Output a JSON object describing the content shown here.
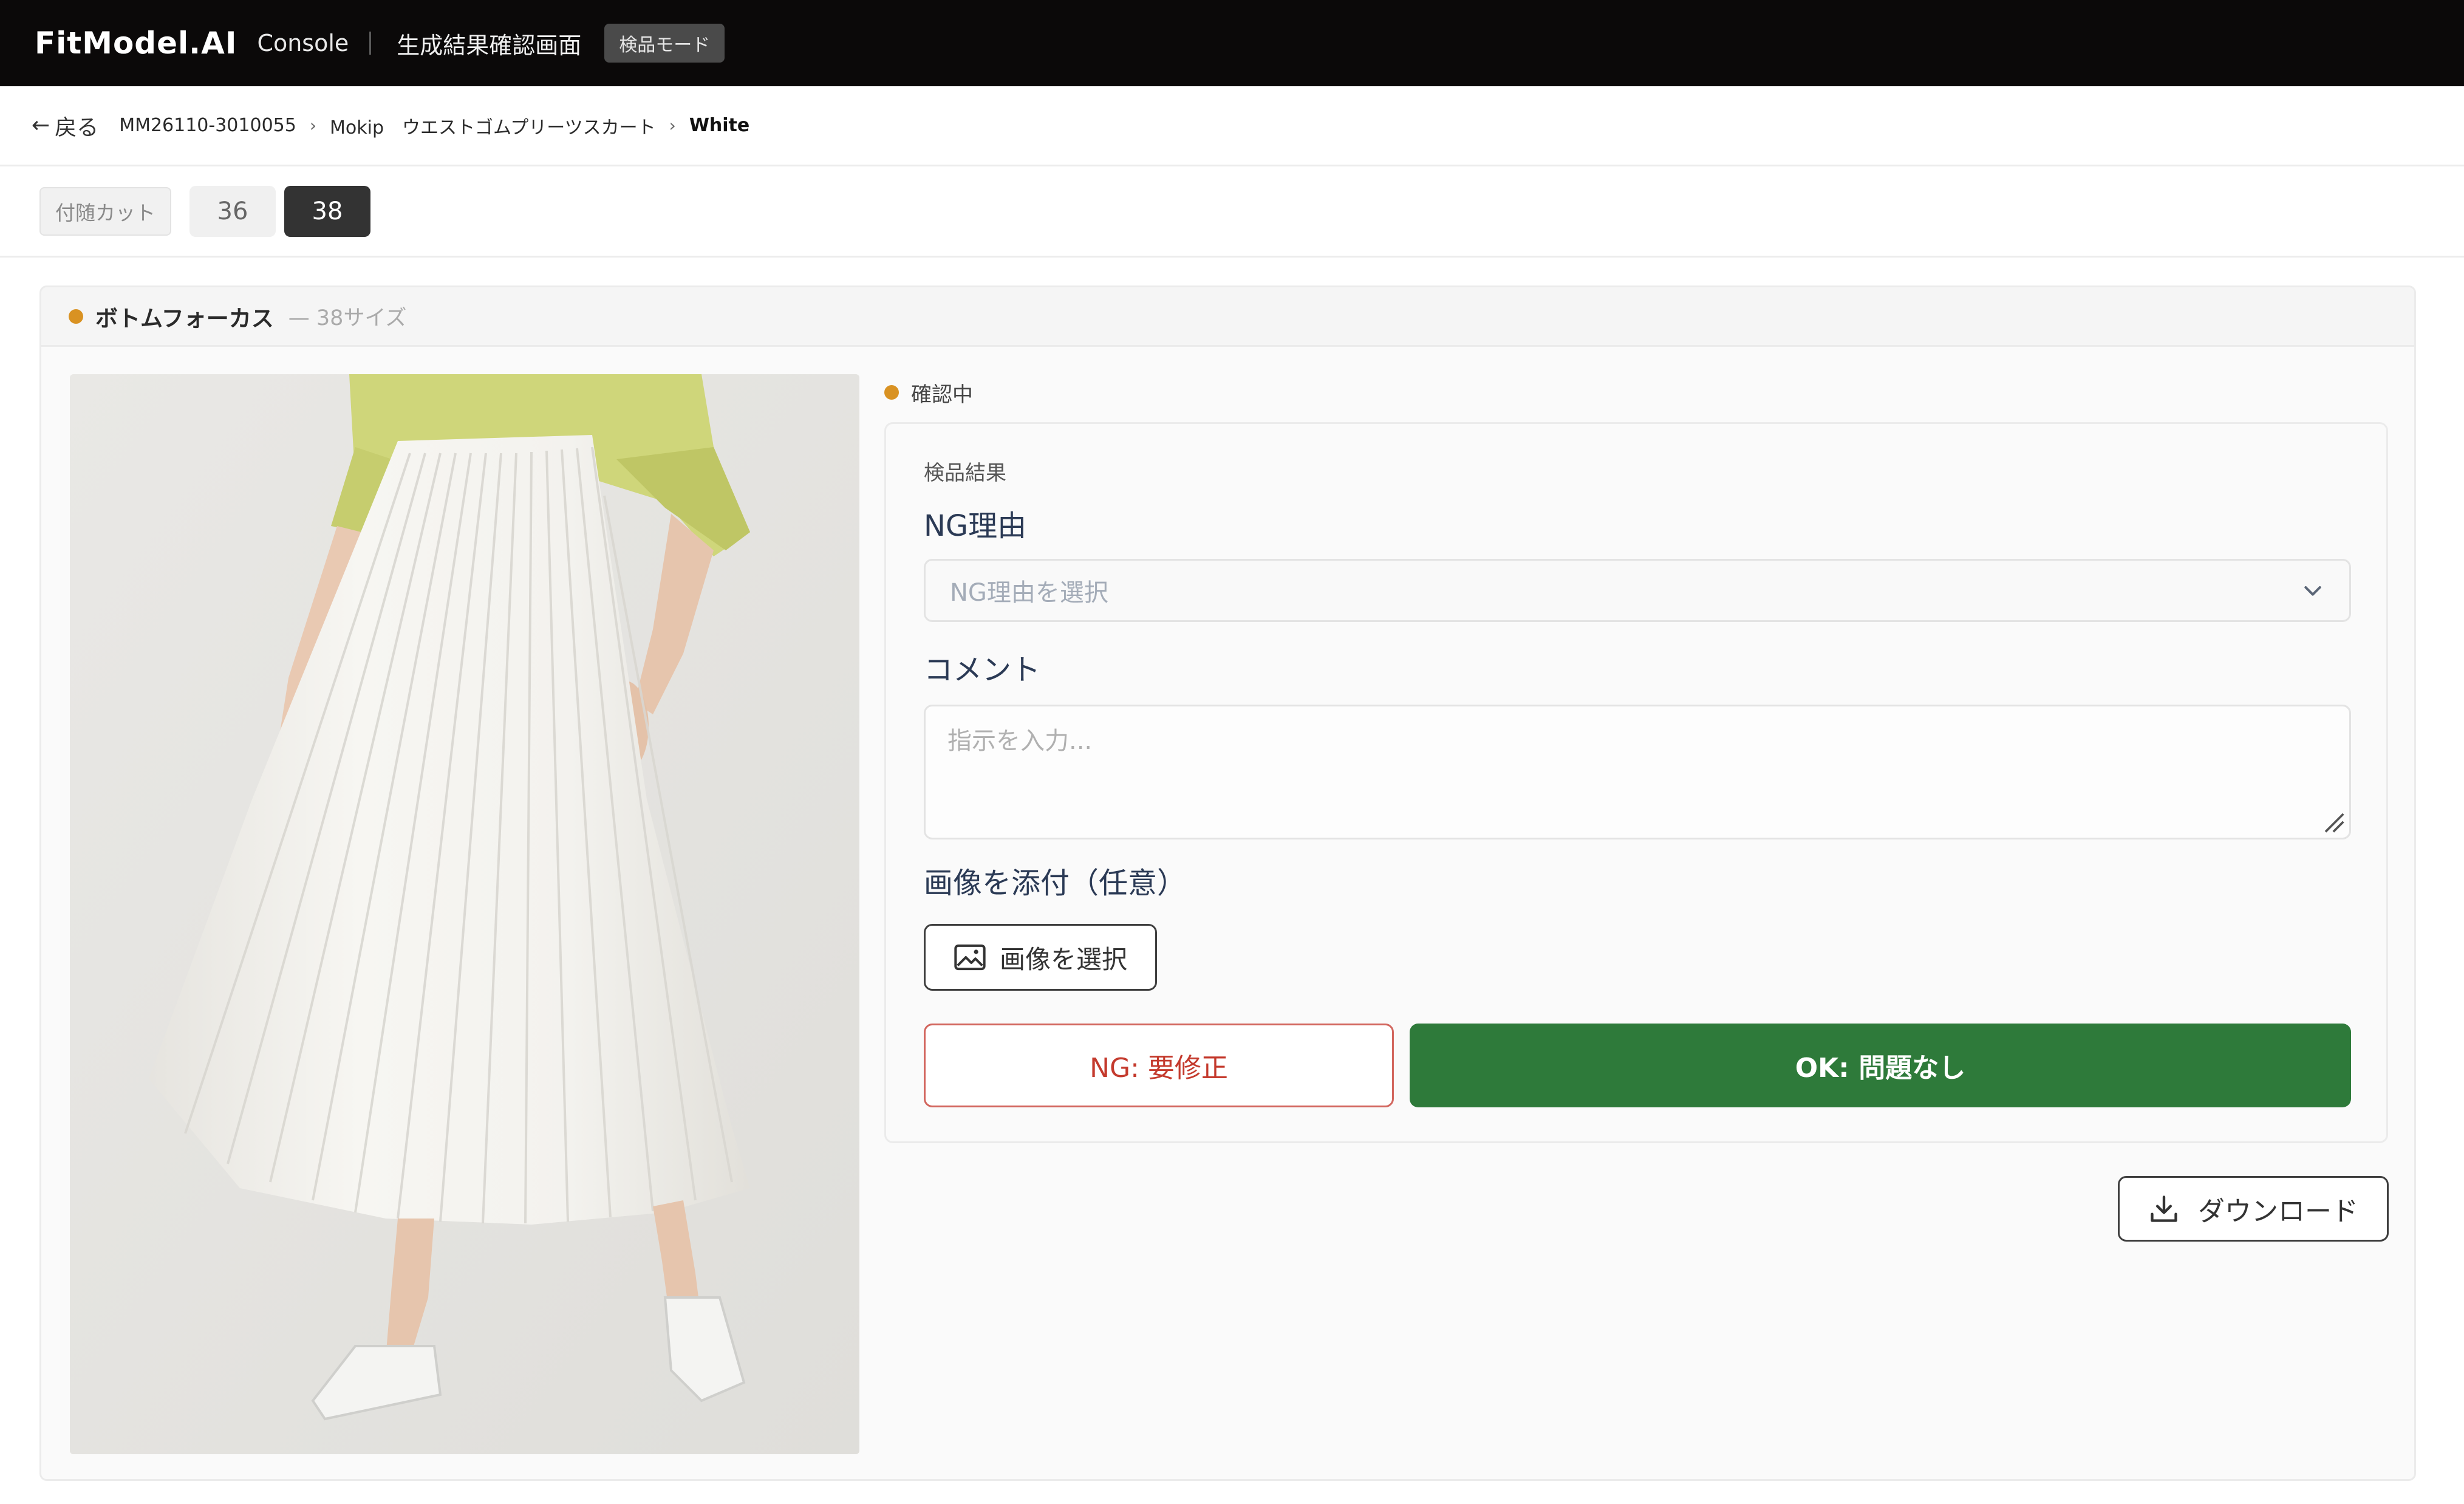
{
  "header": {
    "brand": "FitModel.AI",
    "console": "Console",
    "screen_title": "生成結果確認画面",
    "mode_badge": "検品モード"
  },
  "breadcrumb": {
    "back_label": "戻る",
    "product_code": "MM26110-3010055",
    "product_name": "Mokip　ウエストゴムプリーツスカート",
    "color": "White"
  },
  "size_tabs": {
    "tag_label": "付随カット",
    "sizes": [
      "36",
      "38"
    ],
    "active": "38"
  },
  "card": {
    "title": "ボトムフォーカス",
    "subtitle": "— 38サイズ",
    "status_text": "確認中",
    "status_color": "#d99222"
  },
  "inspection": {
    "section_label": "検品結果",
    "ng_reason_title": "NG理由",
    "ng_reason_placeholder": "NG理由を選択",
    "comment_title": "コメント",
    "comment_placeholder": "指示を入力...",
    "attach_title": "画像を添付（任意）",
    "attach_button": "画像を選択",
    "ng_button": "NG: 要修正",
    "ok_button": "OK: 問題なし"
  },
  "download_button": "ダウンロード",
  "colors": {
    "accent_ok": "#2e7a3a",
    "accent_ng": "#c43a2d",
    "status_dot": "#d99222"
  },
  "icons": {
    "back": "arrow-left-icon",
    "chevron": "chevron-down-icon",
    "image": "image-icon",
    "download": "download-icon",
    "resize": "resize-grip-icon"
  }
}
